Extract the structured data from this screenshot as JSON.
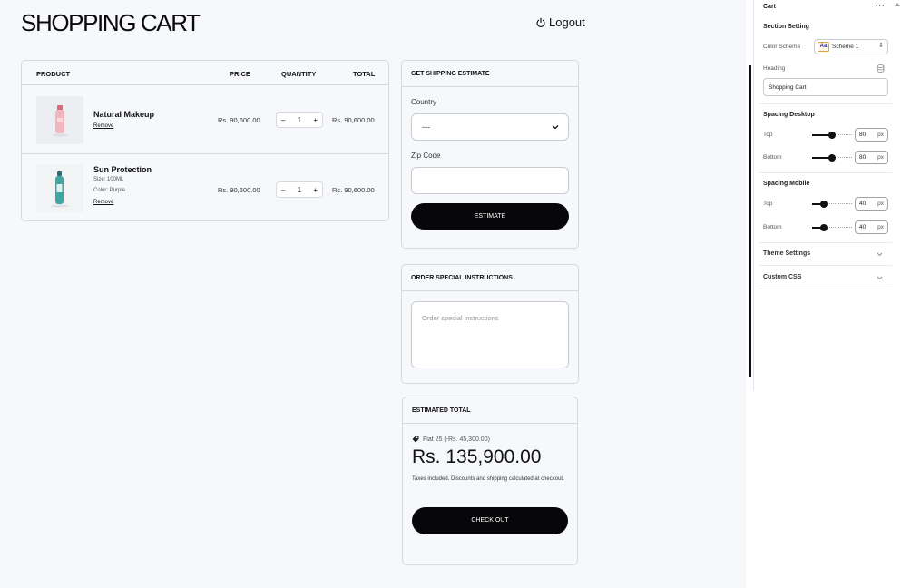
{
  "page": {
    "title": "SHOPPING CART",
    "logout_label": "Logout"
  },
  "cart": {
    "headers": {
      "product": "PRODUCT",
      "price": "PRICE",
      "quantity": "QUANTITY",
      "total": "TOTAL"
    },
    "items": [
      {
        "name": "Natural Makeup",
        "size": "",
        "color": "",
        "remove": "Remove",
        "price": "Rs. 90,600.00",
        "qty": "1",
        "total": "Rs. 90,600.00",
        "image_icon": "pink-bottle-icon"
      },
      {
        "name": "Sun Protection",
        "size": "Size: 100ML",
        "color": "Color: Purple",
        "remove": "Remove",
        "price": "Rs. 90,600.00",
        "qty": "1",
        "total": "Rs. 90,600.00",
        "image_icon": "teal-bottle-icon"
      }
    ],
    "qty_minus": "–",
    "qty_plus": "+"
  },
  "shipping": {
    "title": "GET SHIPPING ESTIMATE",
    "country_label": "Country",
    "country_value": "---",
    "zip_label": "Zip Code",
    "zip_value": "",
    "button": "ESTIMATE"
  },
  "instructions": {
    "title": "ORDER SPECIAL INSTRUCTIONS",
    "placeholder": "Order special instructions"
  },
  "estimate": {
    "title": "ESTIMATED TOTAL",
    "discount": "Flat 25 (-Rs. 45,300.00)",
    "total": "Rs. 135,900.00",
    "note": "Taxes included. Discounts and shipping calculated at checkout.",
    "button": "CHECK OUT"
  },
  "sidebar": {
    "title": "Cart",
    "more": "···",
    "section_setting": "Section Setting",
    "color_scheme_label": "Color Scheme",
    "color_scheme_swatch": "Aa",
    "color_scheme_value": "Scheme 1",
    "heading_label": "Heading",
    "heading_value": "Shopping Cart",
    "spacing_desktop": "Spacing Desktop",
    "spacing_mobile": "Spacing Mobile",
    "top_label": "Top",
    "bottom_label": "Bottom",
    "unit": "px",
    "desktop_top": "80",
    "desktop_bottom": "80",
    "mobile_top": "40",
    "mobile_bottom": "40",
    "slider_max": 200,
    "theme_settings": "Theme Settings",
    "custom_css": "Custom CSS"
  },
  "colors": {
    "accent": "#07070a",
    "canvas": "#f6f8fc",
    "border": "#d7d9de"
  }
}
